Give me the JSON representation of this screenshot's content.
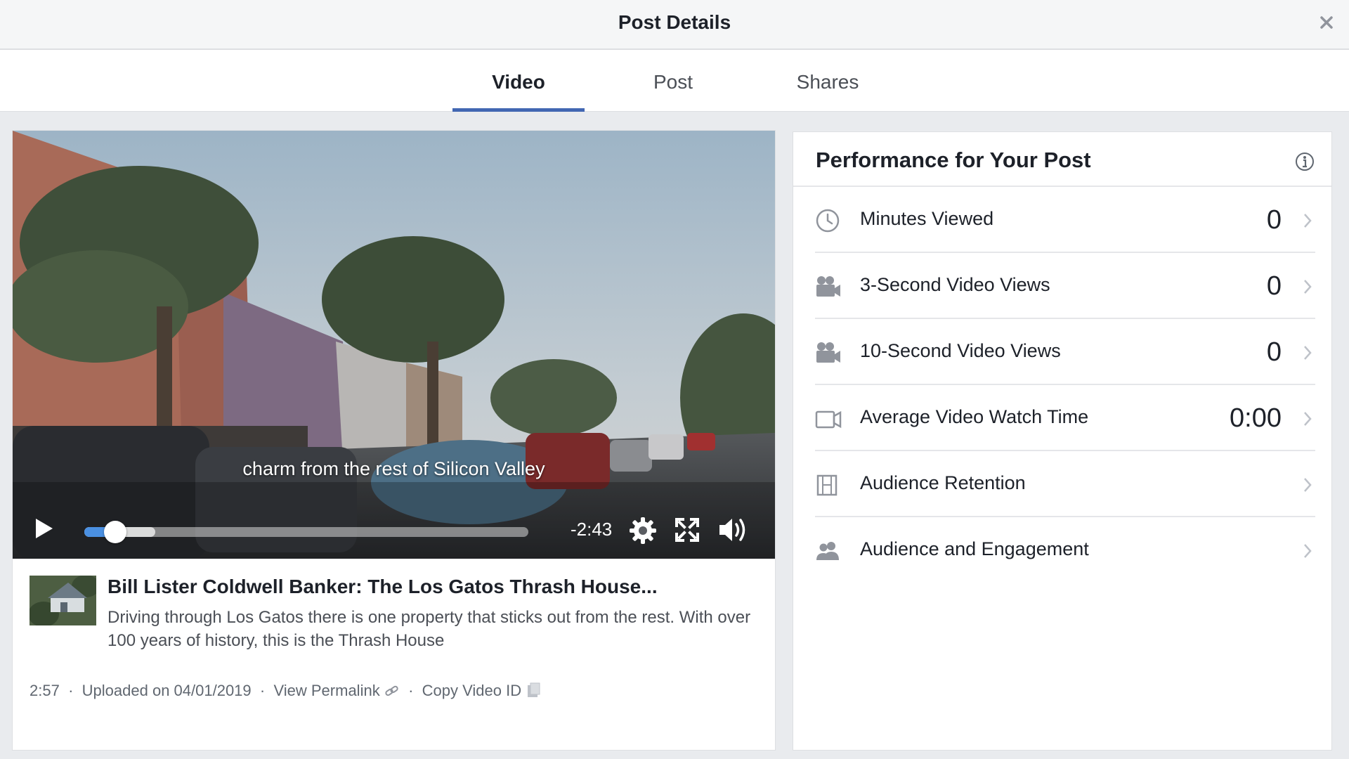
{
  "modal": {
    "title": "Post Details"
  },
  "tabs": [
    {
      "label": "Video",
      "active": true
    },
    {
      "label": "Post",
      "active": false
    },
    {
      "label": "Shares",
      "active": false
    }
  ],
  "video": {
    "caption": "charm from the rest of Silicon Valley",
    "time_remaining": "-2:43",
    "progress_fraction": 0.07,
    "buffered_fraction": 0.16,
    "controls": [
      "play-icon",
      "settings-gear-icon",
      "fullscreen-icon",
      "volume-icon"
    ]
  },
  "post": {
    "title": "Bill Lister Coldwell Banker: The Los Gatos Thrash House...",
    "description": "Driving through Los Gatos there is one property that sticks out from the rest. With over 100 years of history, this is the Thrash House",
    "duration": "2:57",
    "separator": "·",
    "uploaded": "Uploaded on 04/01/2019",
    "permalink_label": "View Permalink",
    "copy_id_label": "Copy Video ID"
  },
  "performance": {
    "title": "Performance for Your Post",
    "metrics": [
      {
        "icon": "clock-icon",
        "label": "Minutes Viewed",
        "value": "0"
      },
      {
        "icon": "video-camera-icon",
        "label": "3-Second Video Views",
        "value": "0"
      },
      {
        "icon": "video-camera-icon",
        "label": "10-Second Video Views",
        "value": "0"
      },
      {
        "icon": "video-outline-icon",
        "label": "Average Video Watch Time",
        "value": "0:00"
      },
      {
        "icon": "film-strip-icon",
        "label": "Audience Retention",
        "value": ""
      },
      {
        "icon": "people-icon",
        "label": "Audience and Engagement",
        "value": ""
      }
    ]
  },
  "colors": {
    "accent": "#4267b2",
    "progress": "#4a90e2",
    "background": "#e9ebee"
  }
}
